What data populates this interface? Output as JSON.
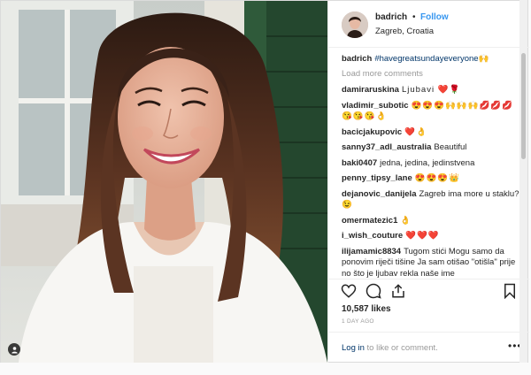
{
  "header": {
    "username": "badrich",
    "dot": "•",
    "follow": "Follow",
    "location": "Zagreb, Croatia"
  },
  "caption": {
    "user": "badrich",
    "text": "#havegreatsundayeveryone🙌"
  },
  "load_more": "Load more comments",
  "comments": [
    {
      "user": "damiraruskina",
      "text": "Ljubavi ❤️🌹"
    },
    {
      "user": "vladimir_subotic",
      "text": "😍😍😍🙌🙌🙌💋💋💋😘😘😘👌"
    },
    {
      "user": "bacicjakupovic",
      "text": "❤️👌"
    },
    {
      "user": "sanny37_adl_australia",
      "text": "Beautiful"
    },
    {
      "user": "baki0407",
      "text": "jedna, jedina, jedinstvena"
    },
    {
      "user": "penny_tipsy_lane",
      "text": "😍😍😍👑"
    },
    {
      "user": "dejanovic_danijela",
      "text": "Zagreb ima more u staklu? 😉"
    },
    {
      "user": "omermatezic1",
      "text": "👌"
    },
    {
      "user": "i_wish_couture",
      "text": "❤️❤️❤️"
    },
    {
      "user": "ilijamamic8834",
      "text": "Tugom stići Mogu samo da ponovim riječi tišine Ja sam otišao \"otišla\" prije no što je ljubav rekla naše ime"
    }
  ],
  "likes": "10,587 likes",
  "time_ago": "1 DAY AGO",
  "login": {
    "link": "Log in",
    "rest": "to like or comment.",
    "more": "•••"
  },
  "icons": {
    "like": "heart-icon",
    "comment": "comment-icon",
    "share": "share-icon",
    "save": "bookmark-icon",
    "multi": "user-tag-icon"
  },
  "colors": {
    "follow": "#3897f0",
    "hashtag": "#003569",
    "muted": "#999999",
    "text": "#262626"
  }
}
